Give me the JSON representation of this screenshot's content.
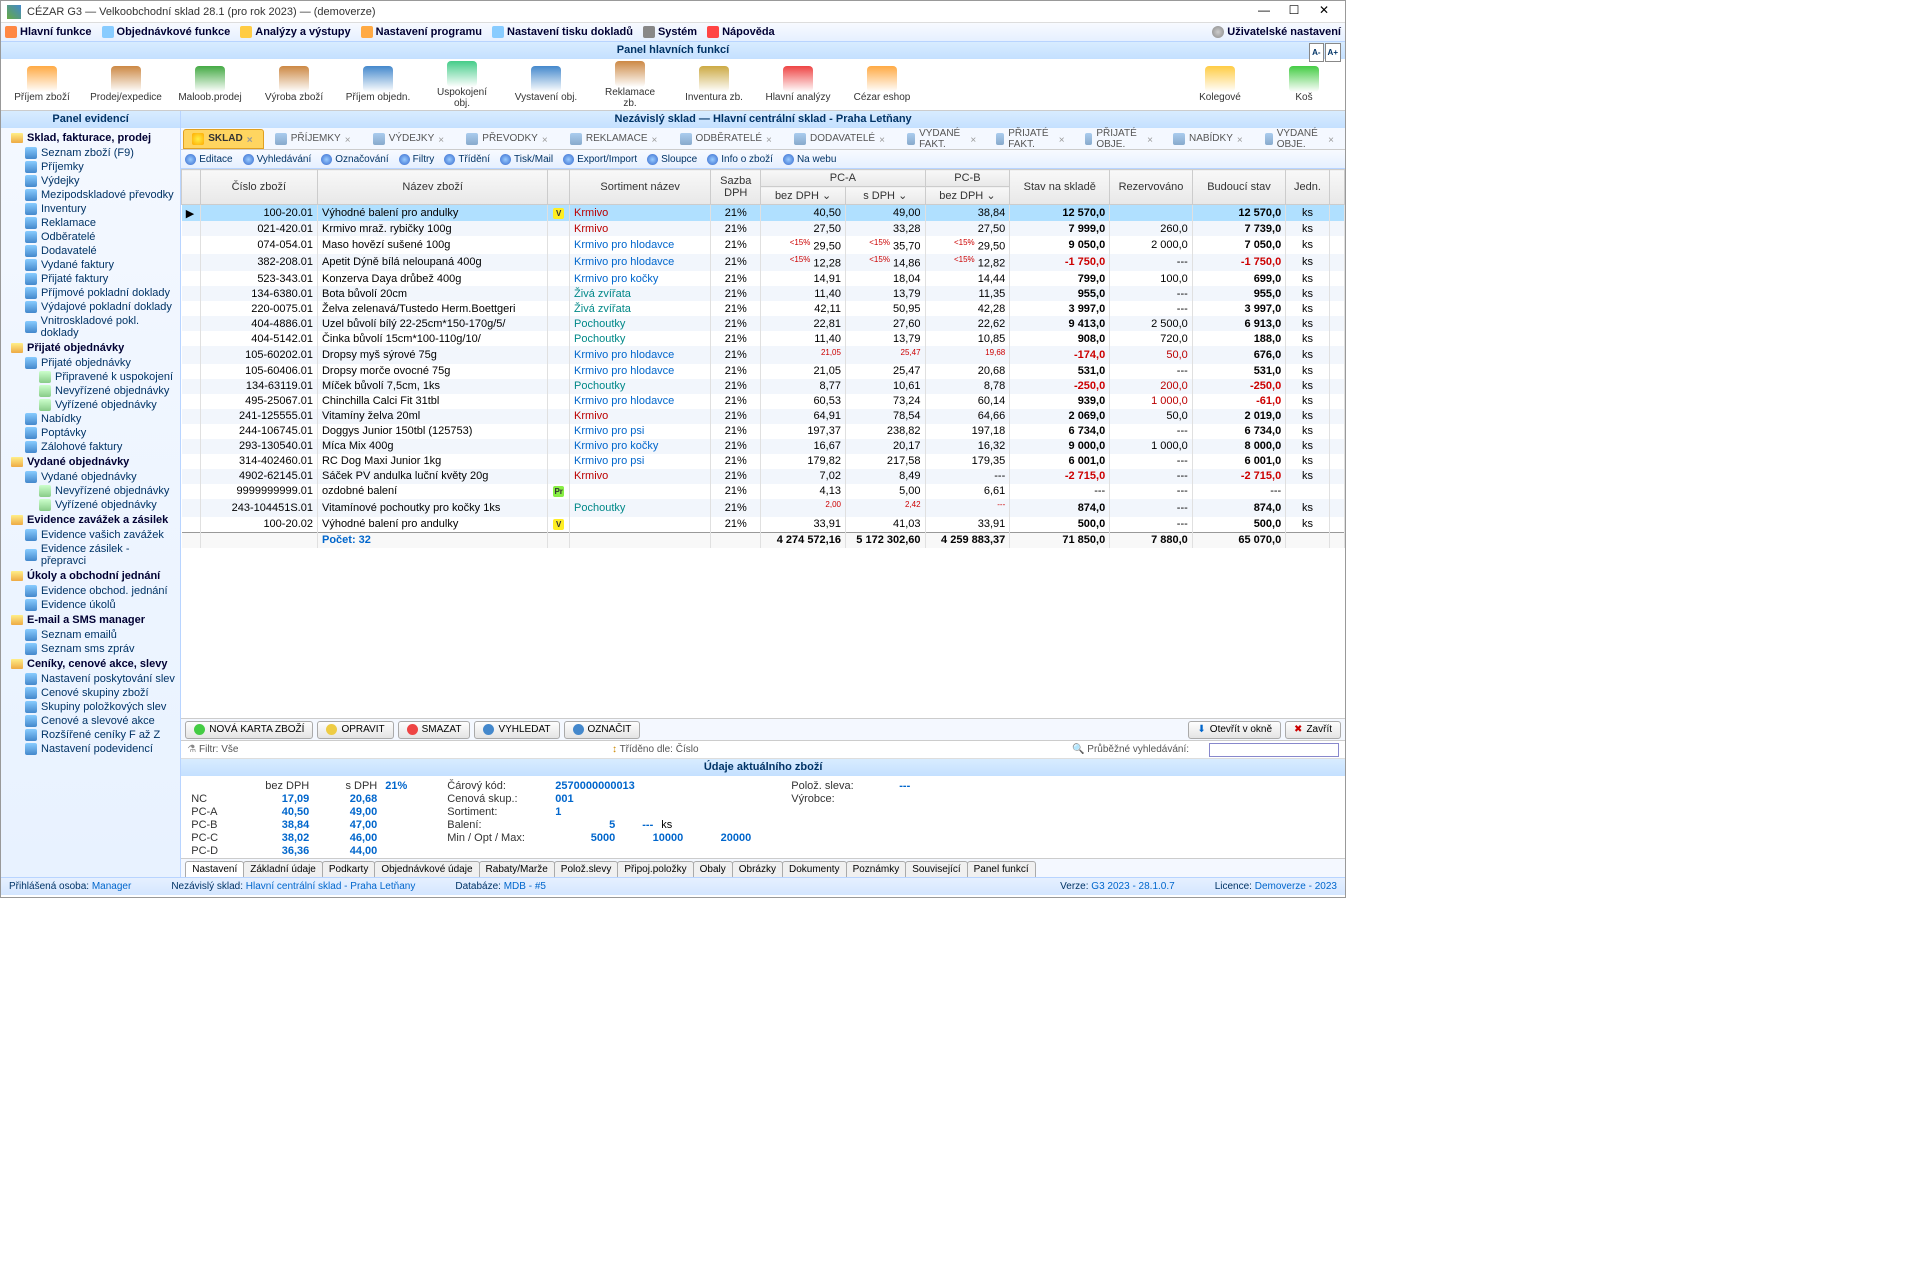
{
  "window": {
    "title": "CÉZAR G3 — Velkoobchodní sklad 28.1  (pro rok 2023) — (demoverze)"
  },
  "menubar": {
    "items": [
      "Hlavní funkce",
      "Objednávkové funkce",
      "Analýzy a výstupy",
      "Nastavení programu",
      "Nastavení tisku dokladů",
      "Systém",
      "Nápověda"
    ],
    "right": "Uživatelské nastavení"
  },
  "funcpanel": {
    "title": "Panel hlavních funkcí",
    "buttons": [
      "Příjem zboží",
      "Prodej/expedice",
      "Maloob.prodej",
      "Výroba zboží",
      "Příjem objedn.",
      "Uspokojení obj.",
      "Vystavení obj.",
      "Reklamace zb.",
      "Inventura zb.",
      "Hlavní analýzy",
      "Cézar eshop"
    ],
    "right": [
      "Kolegové",
      "Koš"
    ]
  },
  "sidepanel": {
    "title": "Panel evidencí",
    "groups": [
      {
        "label": "Sklad, fakturace, prodej",
        "items": [
          {
            "label": "Seznam zboží (F9)"
          },
          {
            "label": "Příjemky"
          },
          {
            "label": "Výdejky"
          },
          {
            "label": "Mezipodskladové převodky"
          },
          {
            "label": "Inventury"
          },
          {
            "label": "Reklamace"
          },
          {
            "label": "Odběratelé"
          },
          {
            "label": "Dodavatelé"
          },
          {
            "label": "Vydané faktury"
          },
          {
            "label": "Přijaté faktury"
          },
          {
            "label": "Příjmové pokladní doklady"
          },
          {
            "label": "Výdajové pokladní doklady"
          },
          {
            "label": "Vnitroskladové pokl. doklady"
          }
        ]
      },
      {
        "label": "Přijaté objednávky",
        "items": [
          {
            "label": "Přijaté objednávky",
            "sub": [
              {
                "label": "Připravené k uspokojení"
              },
              {
                "label": "Nevyřízené objednávky"
              },
              {
                "label": "Vyřízené objednávky"
              }
            ]
          },
          {
            "label": "Nabídky"
          },
          {
            "label": "Poptávky"
          },
          {
            "label": "Zálohové faktury"
          }
        ]
      },
      {
        "label": "Vydané objednávky",
        "items": [
          {
            "label": "Vydané objednávky",
            "sub": [
              {
                "label": "Nevyřízené objednávky"
              },
              {
                "label": "Vyřízené objednávky"
              }
            ]
          }
        ]
      },
      {
        "label": "Evidence zavážek a zásilek",
        "items": [
          {
            "label": "Evidence vašich zavážek"
          },
          {
            "label": "Evidence zásilek - přepravci"
          }
        ]
      },
      {
        "label": "Úkoly a obchodní jednání",
        "items": [
          {
            "label": "Evidence obchod. jednání"
          },
          {
            "label": "Evidence úkolů"
          }
        ]
      },
      {
        "label": "E-mail a SMS manager",
        "items": [
          {
            "label": "Seznam emailů"
          },
          {
            "label": "Seznam sms zpráv"
          }
        ]
      },
      {
        "label": "Ceníky, cenové akce, slevy",
        "items": [
          {
            "label": "Nastavení poskytování slev"
          },
          {
            "label": "Cenové skupiny zboží"
          },
          {
            "label": "Skupiny položkových slev"
          },
          {
            "label": "Cenové a slevové akce"
          },
          {
            "label": "Rozšířené ceníky F až Z"
          },
          {
            "label": "Nastavení podevidencí"
          }
        ]
      }
    ]
  },
  "content": {
    "title": "Nezávislý sklad — Hlavní centrální sklad - Praha Letňany",
    "tabs": [
      {
        "label": "SKLAD",
        "active": true
      },
      {
        "label": "PŘÍJEMKY"
      },
      {
        "label": "VÝDEJKY"
      },
      {
        "label": "PŘEVODKY"
      },
      {
        "label": "REKLAMACE"
      },
      {
        "label": "ODBĚRATELÉ"
      },
      {
        "label": "DODAVATELÉ"
      },
      {
        "label": "VYDANÉ FAKT."
      },
      {
        "label": "PŘIJATÉ FAKT."
      },
      {
        "label": "PŘIJATÉ OBJE."
      },
      {
        "label": "NABÍDKY"
      },
      {
        "label": "VYDANÉ OBJE."
      }
    ],
    "subtoolbar": [
      "Editace",
      "Vyhledávání",
      "Označování",
      "Filtry",
      "Třídění",
      "Tisk/Mail",
      "Export/Import",
      "Sloupce",
      "Info o zboží",
      "Na webu"
    ],
    "columns": {
      "cislo": "Číslo zboží",
      "nazev": "Název zboží",
      "sortiment": "Sortiment název",
      "sazba": "Sazba DPH",
      "pca": "PC-A",
      "pca_bez": "bez DPH",
      "pca_s": "s DPH",
      "pcb": "PC-B",
      "pcb_bez": "bez DPH",
      "stav": "Stav na skladě",
      "rez": "Rezervováno",
      "bud": "Budoucí stav",
      "jedn": "Jedn."
    },
    "rows": [
      {
        "sel": true,
        "cislo": "100-20.01",
        "nazev": "Výhodné balení pro andulky",
        "badge": "V",
        "sort": "Krmivo",
        "sortcls": "redtxt",
        "sazba": "21%",
        "pca_bez": "40,50",
        "pca_s": "49,00",
        "pcb_bez": "38,84",
        "stav": "12 570,0",
        "stavcls": "bold",
        "rez": "",
        "bud": "12 570,0",
        "budcls": "bold",
        "jedn": "ks"
      },
      {
        "cislo": "021-420.01",
        "nazev": "Krmivo mraž. rybičky 100g",
        "sort": "Krmivo",
        "sortcls": "redtxt",
        "sazba": "21%",
        "pca_bez": "27,50",
        "pca_s": "33,28",
        "pcb_bez": "27,50",
        "stav": "7 999,0",
        "stavcls": "bold",
        "rez": "260,0",
        "bud": "7 739,0",
        "budcls": "bold",
        "jedn": "ks"
      },
      {
        "cislo": "074-054.01",
        "nazev": "Maso hovězí sušené 100g",
        "sort": "Krmivo pro hlodavce",
        "sortcls": "blue",
        "sazba": "21%",
        "tag": "<15%",
        "pca_bez": "29,50",
        "pca_s": "35,70",
        "pcb_bez": "29,50",
        "stav": "9 050,0",
        "stavcls": "bold",
        "rez": "2 000,0",
        "bud": "7 050,0",
        "budcls": "bold",
        "jedn": "ks"
      },
      {
        "cislo": "382-208.01",
        "nazev": "Apetit Dýně bílá neloupaná 400g",
        "sort": "Krmivo pro hlodavce",
        "sortcls": "blue",
        "sazba": "21%",
        "tag": "<15%",
        "pca_bez": "12,28",
        "pca_s": "14,86",
        "pcb_bez": "12,82",
        "stav": "-1 750,0",
        "stavcls": "red",
        "rez": "---",
        "bud": "-1 750,0",
        "budcls": "red",
        "jedn": "ks"
      },
      {
        "cislo": "523-343.01",
        "nazev": "Konzerva Daya drůbež 400g",
        "sort": "Krmivo pro kočky",
        "sortcls": "blue",
        "sazba": "21%",
        "pca_bez": "14,91",
        "pca_s": "18,04",
        "pcb_bez": "14,44",
        "stav": "799,0",
        "stavcls": "bold",
        "rez": "100,0",
        "bud": "699,0",
        "budcls": "bold",
        "jedn": "ks"
      },
      {
        "cislo": "134-6380.01",
        "nazev": "Bota bůvolí 20cm",
        "sort": "Živá zvířata",
        "sortcls": "teal",
        "sazba": "21%",
        "pca_bez": "11,40",
        "pca_s": "13,79",
        "pcb_bez": "11,35",
        "stav": "955,0",
        "stavcls": "bold",
        "rez": "---",
        "bud": "955,0",
        "budcls": "bold",
        "jedn": "ks"
      },
      {
        "cislo": "220-0075.01",
        "nazev": "Želva zelenavá/Tustedo Herm.Boettgeri",
        "sort": "Živá zvířata",
        "sortcls": "teal",
        "sazba": "21%",
        "pca_bez": "42,11",
        "pca_s": "50,95",
        "pcb_bez": "42,28",
        "stav": "3 997,0",
        "stavcls": "bold",
        "rez": "---",
        "bud": "3 997,0",
        "budcls": "bold",
        "jedn": "ks"
      },
      {
        "cislo": "404-4886.01",
        "nazev": "Uzel bůvolí bílý 22-25cm*150-170g/5/",
        "sort": "Pochoutky",
        "sortcls": "teal",
        "sazba": "21%",
        "pca_bez": "22,81",
        "pca_s": "27,60",
        "pcb_bez": "22,62",
        "stav": "9 413,0",
        "stavcls": "bold",
        "rez": "2 500,0",
        "bud": "6 913,0",
        "budcls": "bold",
        "jedn": "ks"
      },
      {
        "cislo": "404-5142.01",
        "nazev": "Činka bůvolí 15cm*100-110g/10/",
        "sort": "Pochoutky",
        "sortcls": "teal",
        "sazba": "21%",
        "pca_bez": "11,40",
        "pca_s": "13,79",
        "pcb_bez": "10,85",
        "stav": "908,0",
        "stavcls": "bold",
        "rez": "720,0",
        "bud": "188,0",
        "budcls": "bold",
        "jedn": "ks"
      },
      {
        "cislo": "105-60202.01",
        "nazev": "Dropsy myš sýrové 75g",
        "sort": "Krmivo pro hlodavce",
        "sortcls": "blue",
        "sazba": "21%",
        "tag": "<NC",
        "pca_bez": "21,05",
        "pca_s": "25,47",
        "pcb_bez": "19,68",
        "stav": "-174,0",
        "stavcls": "red",
        "rez": "50,0",
        "rezcls": "redtxt",
        "bud": "676,0",
        "budcls": "bold",
        "jedn": "ks"
      },
      {
        "cislo": "105-60406.01",
        "nazev": "Dropsy morče ovocné 75g",
        "sort": "Krmivo pro hlodavce",
        "sortcls": "blue",
        "sazba": "21%",
        "pca_bez": "21,05",
        "pca_s": "25,47",
        "pcb_bez": "20,68",
        "stav": "531,0",
        "stavcls": "bold",
        "rez": "---",
        "bud": "531,0",
        "budcls": "bold",
        "jedn": "ks"
      },
      {
        "cislo": "134-63119.01",
        "nazev": "Míček bůvolí 7,5cm, 1ks",
        "sort": "Pochoutky",
        "sortcls": "teal",
        "sazba": "21%",
        "pca_bez": "8,77",
        "pca_s": "10,61",
        "pcb_bez": "8,78",
        "stav": "-250,0",
        "stavcls": "red",
        "rez": "200,0",
        "rezcls": "redtxt",
        "bud": "-250,0",
        "budcls": "red",
        "jedn": "ks"
      },
      {
        "cislo": "495-25067.01",
        "nazev": "Chinchilla Calci Fit 31tbl",
        "sort": "Krmivo pro hlodavce",
        "sortcls": "blue",
        "sazba": "21%",
        "pca_bez": "60,53",
        "pca_s": "73,24",
        "pcb_bez": "60,14",
        "stav": "939,0",
        "stavcls": "bold",
        "rez": "1 000,0",
        "rezcls": "redtxt",
        "bud": "-61,0",
        "budcls": "red",
        "jedn": "ks"
      },
      {
        "cislo": "241-125555.01",
        "nazev": "Vitamíny želva 20ml",
        "sort": "Krmivo",
        "sortcls": "redtxt",
        "sazba": "21%",
        "pca_bez": "64,91",
        "pca_s": "78,54",
        "pcb_bez": "64,66",
        "stav": "2 069,0",
        "stavcls": "bold",
        "rez": "50,0",
        "bud": "2 019,0",
        "budcls": "bold",
        "jedn": "ks"
      },
      {
        "cislo": "244-106745.01",
        "nazev": "Doggys Junior 150tbl (125753)",
        "sort": "Krmivo pro psi",
        "sortcls": "blue",
        "sazba": "21%",
        "pca_bez": "197,37",
        "pca_s": "238,82",
        "pcb_bez": "197,18",
        "stav": "6 734,0",
        "stavcls": "bold",
        "rez": "---",
        "bud": "6 734,0",
        "budcls": "bold",
        "jedn": "ks"
      },
      {
        "cislo": "293-130540.01",
        "nazev": "Míca Mix 400g",
        "sort": "Krmivo pro kočky",
        "sortcls": "blue",
        "sazba": "21%",
        "pca_bez": "16,67",
        "pca_s": "20,17",
        "pcb_bez": "16,32",
        "stav": "9 000,0",
        "stavcls": "bold",
        "rez": "1 000,0",
        "bud": "8 000,0",
        "budcls": "bold",
        "jedn": "ks"
      },
      {
        "cislo": "314-402460.01",
        "nazev": "RC Dog Maxi Junior 1kg",
        "sort": "Krmivo pro psi",
        "sortcls": "blue",
        "sazba": "21%",
        "pca_bez": "179,82",
        "pca_s": "217,58",
        "pcb_bez": "179,35",
        "stav": "6 001,0",
        "stavcls": "bold",
        "rez": "---",
        "bud": "6 001,0",
        "budcls": "bold",
        "jedn": "ks"
      },
      {
        "cislo": "4902-62145.01",
        "nazev": "Sáček PV andulka luční květy 20g",
        "sort": "Krmivo",
        "sortcls": "redtxt",
        "sazba": "21%",
        "pca_bez": "7,02",
        "pca_s": "8,49",
        "pcb_bez": "---",
        "stav": "-2 715,0",
        "stavcls": "red",
        "rez": "---",
        "bud": "-2 715,0",
        "budcls": "red",
        "jedn": "ks"
      },
      {
        "cislo": "9999999999.01",
        "nazev": "ozdobné balení",
        "badge": "Pr",
        "sort": "",
        "sazba": "21%",
        "pca_bez": "4,13",
        "pca_s": "5,00",
        "pcb_bez": "6,61",
        "stav": "---",
        "rez": "---",
        "bud": "---",
        "jedn": ""
      },
      {
        "cislo": "243-104451S.01",
        "nazev": "Vitamínové pochoutky pro kočky 1ks",
        "sort": "Pochoutky",
        "sortcls": "teal",
        "sazba": "21%",
        "tag": "<NC",
        "pca_bez": "2,00",
        "pca_s": "2,42",
        "pcb_bez": "---",
        "stav": "874,0",
        "stavcls": "bold",
        "rez": "---",
        "bud": "874,0",
        "budcls": "bold",
        "jedn": "ks"
      },
      {
        "cislo": "100-20.02",
        "nazev": "Výhodné balení pro andulky",
        "badge": "V",
        "sort": "",
        "sazba": "21%",
        "pca_bez": "33,91",
        "pca_s": "41,03",
        "pcb_bez": "33,91",
        "stav": "500,0",
        "stavcls": "bold",
        "rez": "---",
        "bud": "500,0",
        "budcls": "bold",
        "jedn": "ks"
      }
    ],
    "summary": {
      "pocet": "Počet: 32",
      "pca_bez": "4 274 572,16",
      "pca_s": "5 172 302,60",
      "pcb_bez": "4 259 883,37",
      "stav": "71 850,0",
      "rez": "7 880,0",
      "bud": "65 070,0"
    },
    "actions": {
      "nova": "NOVÁ KARTA ZBOŽÍ",
      "opravit": "OPRAVIT",
      "smazat": "SMAZAT",
      "vyhledat": "VYHLEDAT",
      "oznacit": "OZNAČIT",
      "otevrit": "Otevřít v okně",
      "zavrit": "Zavřít"
    },
    "filter": {
      "filtr": "Filtr:",
      "filtrval": "Vše",
      "trideno": "Tříděno dle:",
      "tridenoval": "Číslo",
      "search": "Průběžné vyhledávání:"
    },
    "detail": {
      "title": "Údaje aktuálního zboží",
      "hdr_bez": "bez DPH",
      "hdr_s": "s DPH",
      "hdr_pct": "21%",
      "rows": [
        {
          "lbl": "NC",
          "bez": "17,09",
          "s": "20,68"
        },
        {
          "lbl": "PC-A",
          "bez": "40,50",
          "s": "49,00"
        },
        {
          "lbl": "PC-B",
          "bez": "38,84",
          "s": "47,00"
        },
        {
          "lbl": "PC-C",
          "bez": "38,02",
          "s": "46,00"
        },
        {
          "lbl": "PC-D",
          "bez": "36,36",
          "s": "44,00"
        }
      ],
      "carovy": "Čárový kód:",
      "carovy_v": "2570000000013",
      "cenova": "Cenová skup.:",
      "cenova_v": "001",
      "sortiment": "Sortiment:",
      "sortiment_v": "1",
      "baleni": "Balení:",
      "baleni_v": "5",
      "baleni_dash": "---",
      "baleni_ks": "ks",
      "minopt": "Min / Opt / Max:",
      "min": "5000",
      "opt": "10000",
      "max": "20000",
      "polsleva": "Polož. sleva:",
      "polsleva_v": "---",
      "vyrobce": "Výrobce:"
    },
    "btabs": [
      "Nastavení",
      "Základní údaje",
      "Podkarty",
      "Objednávkové údaje",
      "Rabaty/Marže",
      "Polož.slevy",
      "Připoj.položky",
      "Obaly",
      "Obrázky",
      "Dokumenty",
      "Poznámky",
      "Související",
      "Panel funkcí"
    ]
  },
  "statusbar": {
    "osoba_lbl": "Přihlášená osoba:",
    "osoba": "Manager",
    "sklad_lbl": "Nezávislý sklad:",
    "sklad": "Hlavní centrální sklad - Praha Letňany",
    "db_lbl": "Databáze:",
    "db": "MDB - #5",
    "verze_lbl": "Verze:",
    "verze": "G3 2023 - 28.1.0.7",
    "lic_lbl": "Licence:",
    "lic": "Demoverze - 2023"
  }
}
